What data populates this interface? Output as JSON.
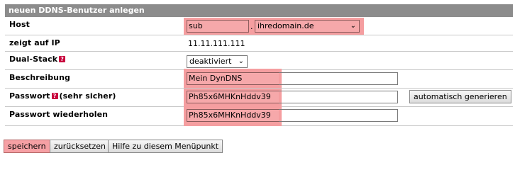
{
  "form": {
    "title": "neuen DDNS-Benutzer anlegen",
    "host": {
      "label": "Host",
      "subdomain_value": "sub",
      "separator": ".",
      "domain_selected": "ihredomain.de"
    },
    "ip": {
      "label": "zeigt auf IP",
      "value": "11.11.111.111"
    },
    "dualstack": {
      "label": "Dual-Stack",
      "help_icon": "question-mark-icon",
      "selected": "deaktiviert"
    },
    "description": {
      "label": "Beschreibung",
      "value": "Mein DynDNS"
    },
    "password": {
      "label_main": "Passwort",
      "label_suffix": "(sehr sicher)",
      "help_icon": "question-mark-icon",
      "value": "Ph85x6MHKnHddv39",
      "generate_button": "automatisch generieren"
    },
    "password_repeat": {
      "label": "Passwort wiederholen",
      "value": "Ph85x6MHKnHddv39"
    }
  },
  "actions": {
    "save": "speichern",
    "reset": "zurücksetzen",
    "help": "Hilfe zu diesem Menüpunkt"
  },
  "colors": {
    "header_bg": "#8c8c8c",
    "highlight": "#f59ea0",
    "help_icon": "#c8003c"
  }
}
